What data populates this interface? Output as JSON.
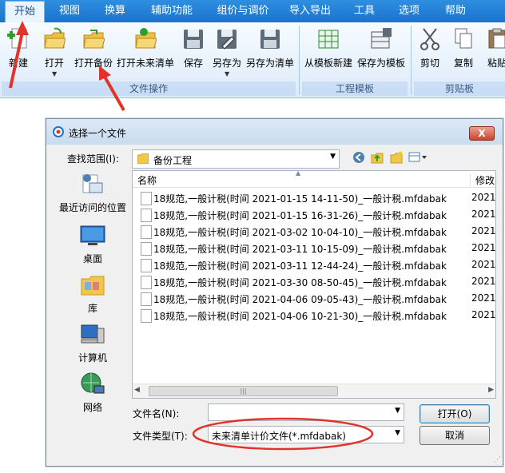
{
  "ribbon": {
    "tabs": [
      {
        "label": "开始"
      },
      {
        "label": "视图"
      },
      {
        "label": "换算"
      },
      {
        "label": "辅助功能"
      },
      {
        "label": "组价与调价"
      },
      {
        "label": "导入导出"
      },
      {
        "label": "工具"
      },
      {
        "label": "选项"
      },
      {
        "label": "帮助"
      }
    ],
    "active_tab": "开始",
    "buttons": {
      "new": "新建",
      "open": "打开",
      "open_backup": "打开备份",
      "open_future": "打开未来清单",
      "save": "保存",
      "save_as": "另存为",
      "save_as_list": "另存为清单",
      "from_template": "从模板新建",
      "save_template": "保存为模板",
      "cut": "剪切",
      "copy": "复制",
      "paste": "粘贴"
    },
    "groups": {
      "file_ops": "文件操作",
      "project_template": "工程模板",
      "clipboard": "剪贴板"
    }
  },
  "dialog": {
    "title": "选择一个文件",
    "close_label": "X",
    "look_in_label": "查找范围(I):",
    "look_in_value": "备份工程",
    "places": [
      {
        "label": "最近访问的位置",
        "icon": "recent-icon"
      },
      {
        "label": "桌面",
        "icon": "desktop-icon"
      },
      {
        "label": "库",
        "icon": "library-icon"
      },
      {
        "label": "计算机",
        "icon": "computer-icon"
      },
      {
        "label": "网络",
        "icon": "network-icon"
      }
    ],
    "columns": {
      "name": "名称",
      "modified": "修改"
    },
    "files": [
      {
        "name": "18规范,一般计税(时间 2021-01-15 14-11-50)_一般计税.mfdabak",
        "date": "2021"
      },
      {
        "name": "18规范,一般计税(时间 2021-01-15 16-31-26)_一般计税.mfdabak",
        "date": "2021"
      },
      {
        "name": "18规范,一般计税(时间 2021-03-02 10-04-10)_一般计税.mfdabak",
        "date": "2021"
      },
      {
        "name": "18规范,一般计税(时间 2021-03-11 10-15-09)_一般计税.mfdabak",
        "date": "2021"
      },
      {
        "name": "18规范,一般计税(时间 2021-03-11 12-44-24)_一般计税.mfdabak",
        "date": "2021"
      },
      {
        "name": "18规范,一般计税(时间 2021-03-30 08-50-45)_一般计税.mfdabak",
        "date": "2021"
      },
      {
        "name": "18规范,一般计税(时间 2021-04-06 09-05-43)_一般计税.mfdabak",
        "date": "2021"
      },
      {
        "name": "18规范,一般计税(时间 2021-04-06 10-21-30)_一般计税.mfdabak",
        "date": "2021"
      }
    ],
    "file_name_label": "文件名(N):",
    "file_name_value": "",
    "file_type_label": "文件类型(T):",
    "file_type_value": "未来清单计价文件(*.mfdabak)",
    "open_button": "打开(O)",
    "cancel_button": "取消"
  },
  "colors": {
    "ribbon_blue": "#1a73cc",
    "annotation_red": "#e0342a"
  }
}
